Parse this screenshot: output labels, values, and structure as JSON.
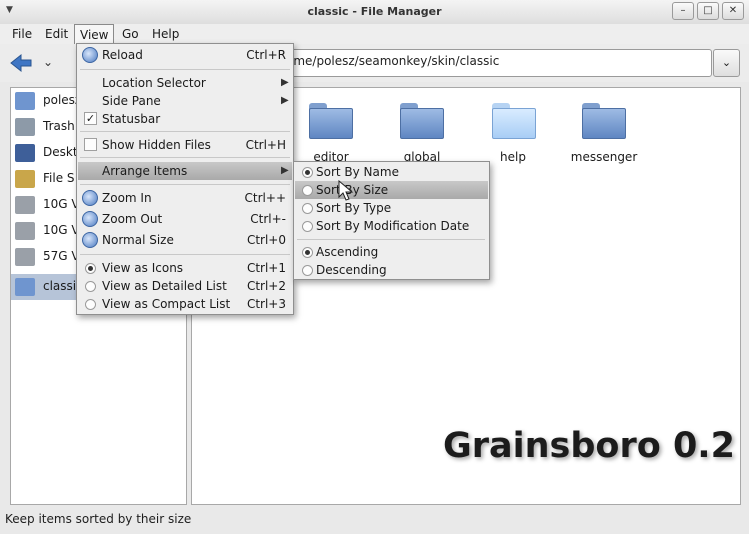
{
  "window": {
    "title": "classic - File Manager",
    "min_glyph": "–",
    "max_glyph": "□",
    "close_glyph": "✕"
  },
  "menubar": [
    "File",
    "Edit",
    "View",
    "Go",
    "Help"
  ],
  "toolbar": {
    "location_path": "ome/polesz/seamonkey/skin/classic"
  },
  "side_pane": {
    "items": [
      {
        "label": "polesz",
        "icon": "home-icon"
      },
      {
        "label": "Trash",
        "icon": "trash-icon"
      },
      {
        "label": "Deskt",
        "icon": "desktop-icon"
      },
      {
        "label": "File S",
        "icon": "filesystem-icon"
      },
      {
        "label": "10G V",
        "icon": "drive-icon"
      },
      {
        "label": "10G V",
        "icon": "drive-icon"
      },
      {
        "label": "57G V",
        "icon": "drive-icon"
      },
      {
        "label": "classi",
        "icon": "folder-icon",
        "selected": true
      }
    ]
  },
  "folders": [
    {
      "label": "editor"
    },
    {
      "label": "global"
    },
    {
      "label": "help"
    },
    {
      "label": "messenger"
    }
  ],
  "watermark": "Grainsboro 0.2",
  "status_text": "Keep items sorted by their size",
  "view_menu": {
    "reload": {
      "label": "Reload",
      "shortcut": "Ctrl+R"
    },
    "location_selector": "Location Selector",
    "side_pane": "Side Pane",
    "statusbar": "Statusbar",
    "show_hidden": {
      "label": "Show Hidden Files",
      "shortcut": "Ctrl+H"
    },
    "arrange_items": "Arrange Items",
    "zoom_in": {
      "label": "Zoom In",
      "shortcut": "Ctrl++"
    },
    "zoom_out": {
      "label": "Zoom Out",
      "shortcut": "Ctrl+-"
    },
    "normal_size": {
      "label": "Normal Size",
      "shortcut": "Ctrl+0"
    },
    "view_icons": {
      "label": "View as Icons",
      "shortcut": "Ctrl+1"
    },
    "view_detailed": {
      "label": "View as Detailed List",
      "shortcut": "Ctrl+2"
    },
    "view_compact": {
      "label": "View as Compact List",
      "shortcut": "Ctrl+3"
    }
  },
  "sort_menu": {
    "by_name": "Sort By Name",
    "by_size": "Sort By Size",
    "by_type": "Sort By Type",
    "by_mtime": "Sort By Modification Date",
    "ascending": "Ascending",
    "descending": "Descending"
  },
  "colors": {
    "accent": "#3f76c4",
    "selection": "#b6c4d8",
    "menu_highlight": "#b0b0b0"
  }
}
